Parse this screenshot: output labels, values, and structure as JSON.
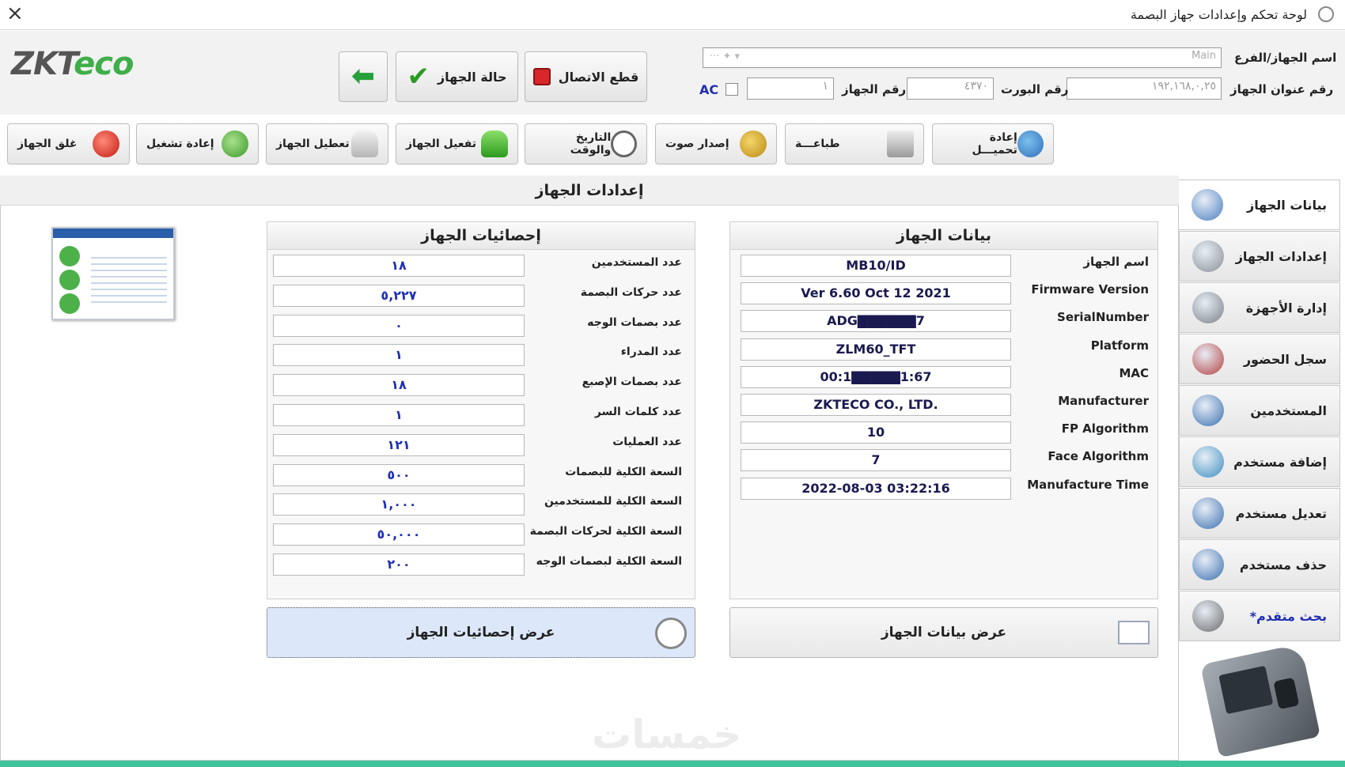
{
  "window": {
    "title": "لوحة تحكم وإعدادات جهاز البصمة",
    "close_label": "×"
  },
  "header": {
    "logo_main": "ZKT",
    "logo_accent": "eco",
    "disconnect_label": "قطع الاتصال",
    "status_label": "حالة الجهاز",
    "device_branch_label": "اسم الجهاز/الفرع",
    "device_branch_value": "Main",
    "ip_label": "رقم عنوان الجهاز",
    "ip_value": "١٩٢,١٦٨,٠,٢٥",
    "port_label": "رقم البورت",
    "port_value": "٤٣٧٠",
    "device_no_label": "رقم الجهاز",
    "device_no_value": "١",
    "ac_label": "AC"
  },
  "toolbar": [
    {
      "label": "إعادة تحميـــل",
      "icon": "refresh-icon"
    },
    {
      "label": "طباعـــة",
      "icon": "printer-icon"
    },
    {
      "label": "إصدار صوت",
      "icon": "bell-icon"
    },
    {
      "label": "التاريخ والوقت",
      "icon": "clock-icon"
    },
    {
      "label": "تفعيل الجهاز",
      "icon": "enable-icon"
    },
    {
      "label": "تعطيل الجهاز",
      "icon": "disable-icon"
    },
    {
      "label": "إعادة تشغيل",
      "icon": "restart-icon"
    },
    {
      "label": "غلق الجهاز",
      "icon": "power-icon"
    }
  ],
  "main": {
    "title": "إعدادات الجهاز",
    "device_info": {
      "title": "بيانات الجهاز",
      "rows": [
        {
          "label": "اسم الجهاز",
          "value": "MB10/ID"
        },
        {
          "label": "Firmware Version",
          "value": "Ver 6.60 Oct 12 2021"
        },
        {
          "label": "SerialNumber",
          "value": "ADG▇▇▇▇▇▇7"
        },
        {
          "label": "Platform",
          "value": "ZLM60_TFT"
        },
        {
          "label": "MAC",
          "value": "00:1▇▇▇▇▇1:67"
        },
        {
          "label": "Manufacturer",
          "value": "ZKTECO CO., LTD."
        },
        {
          "label": "FP Algorithm",
          "value": "10"
        },
        {
          "label": "Face Algorithm",
          "value": "7"
        },
        {
          "label": "Manufacture Time",
          "value": "2022-08-03 03:22:16"
        }
      ],
      "button_label": "عرض بيانات الجهاز"
    },
    "device_stats": {
      "title": "إحصائيات الجهاز",
      "rows": [
        {
          "label": "عدد المستخدمين",
          "value": "١٨"
        },
        {
          "label": "عدد حركات البصمة",
          "value": "٥,٢٢٧"
        },
        {
          "label": "عدد بصمات الوجه",
          "value": "٠"
        },
        {
          "label": "عدد المدراء",
          "value": "١"
        },
        {
          "label": "عدد بصمات الإصبع",
          "value": "١٨"
        },
        {
          "label": "عدد كلمات السر",
          "value": "١"
        },
        {
          "label": "عدد العمليات",
          "value": "١٢١"
        },
        {
          "label": "السعة الكلية للبصمات",
          "value": "٥٠٠"
        },
        {
          "label": "السعة الكلية للمستخدمين",
          "value": "١,٠٠٠"
        },
        {
          "label": "السعة الكلية لحركات البصمة",
          "value": "٥٠,٠٠٠"
        },
        {
          "label": "السعة الكلية لبصمات الوجه",
          "value": "٢٠٠"
        }
      ],
      "button_label": "عرض إحصائيات الجهاز"
    },
    "watermark": "خمسات"
  },
  "sidebar": [
    {
      "label": "بيانات الجهاز",
      "icon": "list-icon",
      "active": true
    },
    {
      "label": "إعدادات الجهاز",
      "icon": "gears-icon"
    },
    {
      "label": "إدارة الأجهزة",
      "icon": "devices-gear-icon"
    },
    {
      "label": "سجل الحضور",
      "icon": "attendance-clock-icon"
    },
    {
      "label": "المستخدمين",
      "icon": "users-search-icon"
    },
    {
      "label": "إضافة مستخدم",
      "icon": "user-add-icon"
    },
    {
      "label": "تعديل مستخدم",
      "icon": "user-edit-icon"
    },
    {
      "label": "حذف مستخدم",
      "icon": "user-delete-icon"
    },
    {
      "label": "بحث متقدم*",
      "icon": "magnifier-icon",
      "accent": "#1f2fb5"
    }
  ]
}
